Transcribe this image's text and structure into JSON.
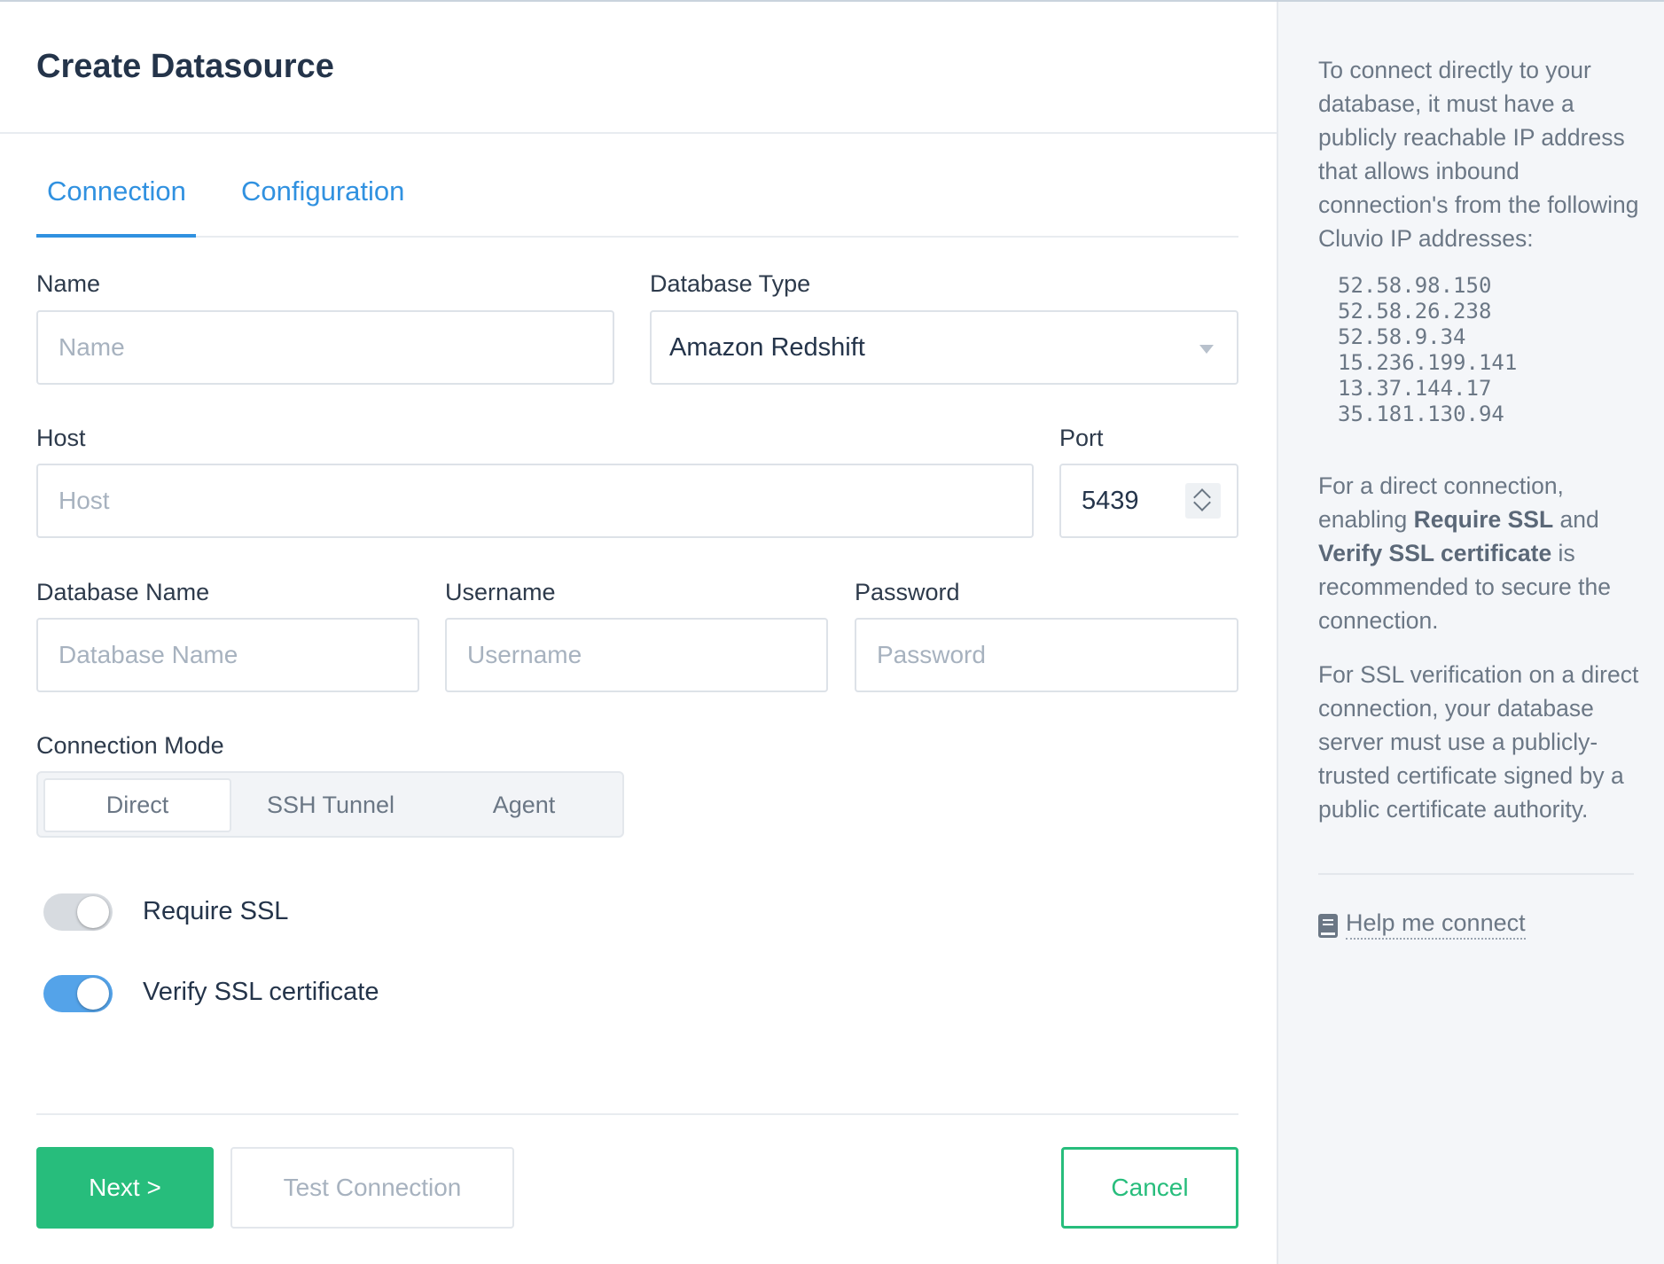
{
  "page": {
    "title": "Create Datasource"
  },
  "tabs": [
    {
      "label": "Connection",
      "active": true
    },
    {
      "label": "Configuration",
      "active": false
    }
  ],
  "form": {
    "name": {
      "label": "Name",
      "placeholder": "Name",
      "value": ""
    },
    "database_type": {
      "label": "Database Type",
      "value": "Amazon Redshift"
    },
    "host": {
      "label": "Host",
      "placeholder": "Host",
      "value": ""
    },
    "port": {
      "label": "Port",
      "value": "5439"
    },
    "database_name": {
      "label": "Database Name",
      "placeholder": "Database Name",
      "value": ""
    },
    "username": {
      "label": "Username",
      "placeholder": "Username",
      "value": ""
    },
    "password": {
      "label": "Password",
      "placeholder": "Password",
      "value": ""
    },
    "connection_mode": {
      "label": "Connection Mode",
      "options": [
        "Direct",
        "SSH Tunnel",
        "Agent"
      ],
      "selected": "Direct"
    },
    "require_ssl": {
      "label": "Require SSL",
      "on": false
    },
    "verify_ssl": {
      "label": "Verify SSL certificate",
      "on": true
    }
  },
  "buttons": {
    "next": "Next >",
    "test_connection": "Test Connection",
    "cancel": "Cancel"
  },
  "sidebar": {
    "intro": "To connect directly to your database, it must have a publicly reachable IP address that allows inbound connection's from the following Cluvio IP addresses:",
    "ips": [
      "52.58.98.150",
      "52.58.26.238",
      "52.58.9.34",
      "15.236.199.141",
      "13.37.144.17",
      "35.181.130.94"
    ],
    "ssl_note": {
      "prefix": "For a direct connection, enabling ",
      "require_ssl": "Require SSL",
      "and": " and ",
      "verify_ssl": "Verify SSL certificate",
      "suffix": " is recommended to secure the connection."
    },
    "verification_note": "For SSL verification on a direct connection, your database server must use a publicly-trusted certificate signed by a public certificate authority.",
    "help_link": "Help me connect",
    "help_icon": "book-icon"
  },
  "colors": {
    "accent_blue": "#3091e0",
    "primary_green": "#27bd7c",
    "toggle_on": "#54a3e9",
    "toggle_off": "#d7dbe0",
    "sidebar_bg": "#f4f6f9"
  }
}
